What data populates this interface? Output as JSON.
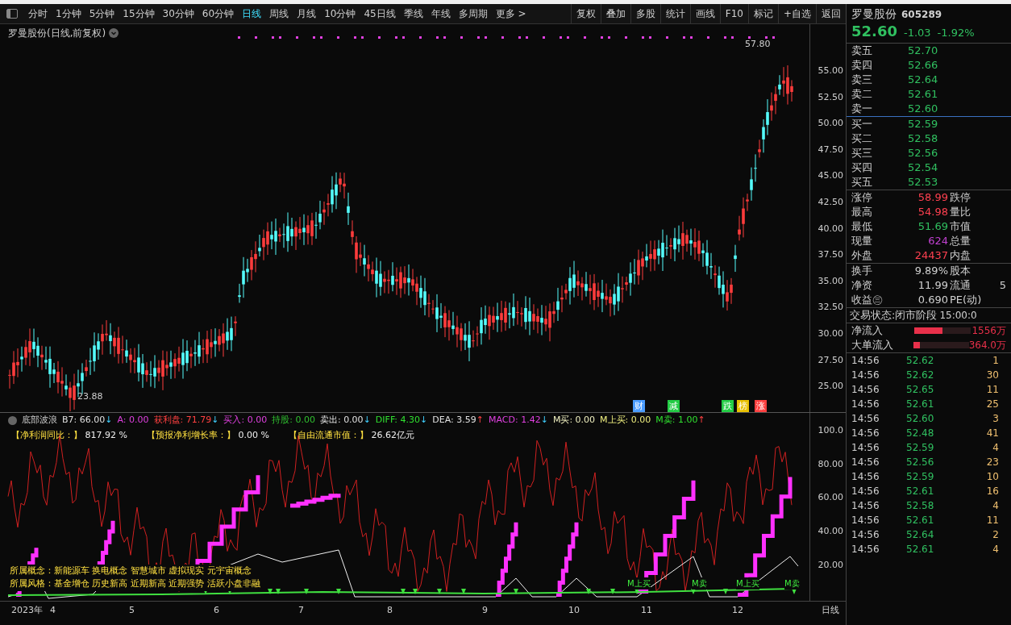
{
  "toolbar": {
    "periods": [
      {
        "label": "分时",
        "selected": false
      },
      {
        "label": "1分钟",
        "selected": false
      },
      {
        "label": "5分钟",
        "selected": false
      },
      {
        "label": "15分钟",
        "selected": false
      },
      {
        "label": "30分钟",
        "selected": false
      },
      {
        "label": "60分钟",
        "selected": false
      },
      {
        "label": "日线",
        "selected": true
      },
      {
        "label": "周线",
        "selected": false
      },
      {
        "label": "月线",
        "selected": false
      },
      {
        "label": "10分钟",
        "selected": false
      },
      {
        "label": "45日线",
        "selected": false
      },
      {
        "label": "季线",
        "selected": false
      },
      {
        "label": "年线",
        "selected": false
      },
      {
        "label": "多周期",
        "selected": false
      }
    ],
    "more": "更多 >",
    "actions": [
      "复权",
      "叠加",
      "多股",
      "统计",
      "画线",
      "F10",
      "标记",
      "+自选",
      "返回"
    ]
  },
  "chart": {
    "title": "罗曼股份(日线,前复权)",
    "high_label": "57.80",
    "low_label": "23.88",
    "y_axis": [
      "55.00",
      "52.50",
      "50.00",
      "47.50",
      "45.00",
      "42.50",
      "40.00",
      "37.50",
      "35.00",
      "32.50",
      "30.00",
      "27.50",
      "25.00"
    ],
    "markers": [
      {
        "label": "财",
        "color": "#4a9cff"
      },
      {
        "label": "减",
        "color": "#22cc44"
      },
      {
        "label": "跌",
        "color": "#22cc44"
      },
      {
        "label": "榜",
        "color": "#e8c000"
      },
      {
        "label": "涨",
        "color": "#ff4040"
      }
    ]
  },
  "indicator": {
    "name": "底部波浪",
    "values": [
      {
        "label": "B7:",
        "value": "66.00",
        "arrow": "↓",
        "color": "#e0e0e0",
        "rising": false
      },
      {
        "label": "A:",
        "value": "0.00",
        "color": "#e040e0"
      },
      {
        "label": "获利盘:",
        "value": "71.79",
        "arrow": "↓",
        "color": "#ff4040",
        "rising": false
      },
      {
        "label": "买入:",
        "value": "0.00",
        "color": "#e040e0"
      },
      {
        "label": "持股:",
        "value": "0.00",
        "color": "#30c030"
      },
      {
        "label": "卖出:",
        "value": "0.00",
        "arrow": "↓",
        "color": "#e0e0e0",
        "rising": false
      },
      {
        "label": "DIFF:",
        "value": "4.30",
        "arrow": "↓",
        "color": "#30e030",
        "rising": false
      },
      {
        "label": "DEA:",
        "value": "3.59",
        "arrow": "↑",
        "color": "#e0e0e0",
        "rising": true
      },
      {
        "label": "MACD:",
        "value": "1.42",
        "arrow": "↓",
        "color": "#e040e0",
        "rising": false
      },
      {
        "label": "M买:",
        "value": "0.00",
        "color": "#f0f0c0"
      },
      {
        "label": "M上买:",
        "value": "0.00",
        "color": "#f0f080"
      },
      {
        "label": "M卖:",
        "value": "1.00",
        "arrow": "↑",
        "color": "#30e030",
        "rising": true
      }
    ],
    "fundamentals": [
      {
        "label": "【净利润同比：】",
        "value": "817.92 %"
      },
      {
        "label": "【预报净利增长率：】",
        "value": "0.00 %"
      },
      {
        "label": "【自由流通市值：】",
        "value": "26.62亿元"
      }
    ],
    "y_axis": [
      "100.0",
      "80.00",
      "60.00",
      "40.00",
      "20.00"
    ],
    "concepts": "所属概念：新能源车 换电概念 智慧城市 虚拟现实 元宇宙概念",
    "styles": "所属风格：基金增仓 历史新高 近期新高 近期强势 活跃小盘非融",
    "signals": [
      "M上买",
      "M卖",
      "M上买",
      "M卖"
    ]
  },
  "x_axis": {
    "labels": [
      "2023年",
      "4",
      "5",
      "6",
      "7",
      "8",
      "9",
      "10",
      "11",
      "12"
    ],
    "period": "日线"
  },
  "quote": {
    "name": "罗曼股份",
    "code": "605289",
    "price": "52.60",
    "change": "-1.03",
    "percent": "-1.92%",
    "asks": [
      {
        "label": "卖五",
        "price": "52.70"
      },
      {
        "label": "卖四",
        "price": "52.66"
      },
      {
        "label": "卖三",
        "price": "52.64"
      },
      {
        "label": "卖二",
        "price": "52.61"
      },
      {
        "label": "卖一",
        "price": "52.60"
      }
    ],
    "bids": [
      {
        "label": "买一",
        "price": "52.59"
      },
      {
        "label": "买二",
        "price": "52.58"
      },
      {
        "label": "买三",
        "price": "52.56"
      },
      {
        "label": "买四",
        "price": "52.54"
      },
      {
        "label": "买五",
        "price": "52.53"
      }
    ],
    "stats": [
      {
        "label": "涨停",
        "value": "58.99",
        "color": "#ff4050",
        "label2": "跌停"
      },
      {
        "label": "最高",
        "value": "54.98",
        "color": "#ff4050",
        "label2": "量比"
      },
      {
        "label": "最低",
        "value": "51.69",
        "color": "#30c060",
        "label2": "市值"
      },
      {
        "label": "现量",
        "value": "624",
        "color": "#c040d0",
        "label2": "总量"
      },
      {
        "label": "外盘",
        "value": "24437",
        "color": "#ff4050",
        "label2": "内盘"
      }
    ],
    "stats2": [
      {
        "label": "换手",
        "value": "9.89%",
        "label2": "股本"
      },
      {
        "label": "净资",
        "value": "11.99",
        "label2": "流通",
        "value2": "5"
      },
      {
        "label": "收益㊂",
        "value": "0.690",
        "label2": "PE(动)"
      }
    ],
    "status": {
      "label": "交易状态:",
      "value": "闭市阶段",
      "time": "15:00:0"
    },
    "flows": [
      {
        "label": "净流入",
        "value": "1556万",
        "level": 0.5
      },
      {
        "label": "大单流入",
        "value": "364.0万",
        "level": 0.12
      }
    ],
    "trades": [
      {
        "time": "14:56",
        "price": "52.62",
        "volume": "1"
      },
      {
        "time": "14:56",
        "price": "52.62",
        "volume": "30"
      },
      {
        "time": "14:56",
        "price": "52.65",
        "volume": "11"
      },
      {
        "time": "14:56",
        "price": "52.61",
        "volume": "25"
      },
      {
        "time": "14:56",
        "price": "52.60",
        "volume": "3"
      },
      {
        "time": "14:56",
        "price": "52.48",
        "volume": "41"
      },
      {
        "time": "14:56",
        "price": "52.59",
        "volume": "4"
      },
      {
        "time": "14:56",
        "price": "52.56",
        "volume": "23"
      },
      {
        "time": "14:56",
        "price": "52.59",
        "volume": "10"
      },
      {
        "time": "14:56",
        "price": "52.61",
        "volume": "16"
      },
      {
        "time": "14:56",
        "price": "52.58",
        "volume": "4"
      },
      {
        "time": "14:56",
        "price": "52.61",
        "volume": "11"
      },
      {
        "time": "14:56",
        "price": "52.64",
        "volume": "2"
      },
      {
        "time": "14:56",
        "price": "52.61",
        "volume": "4"
      }
    ]
  }
}
